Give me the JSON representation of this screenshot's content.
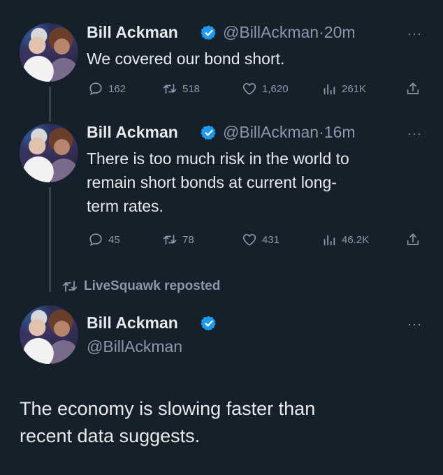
{
  "tweets": [
    {
      "author": "Bill Ackman",
      "handle": "@BillAckman",
      "time_sep": "·",
      "time": "20m",
      "text": "We covered our bond short.",
      "replies": "162",
      "reposts": "518",
      "likes": "1,620",
      "views": "261K"
    },
    {
      "author": "Bill Ackman",
      "handle": "@BillAckman",
      "time_sep": "·",
      "time": "16m",
      "text_lines": [
        "There is too much risk in the world to",
        "remain short bonds at current long-",
        "term rates."
      ],
      "replies": "45",
      "reposts": "78",
      "likes": "431",
      "views": "46.2K"
    }
  ],
  "repost": {
    "label": "LiveSquawk reposted",
    "author": "Bill Ackman",
    "handle": "@BillAckman",
    "text_lines": [
      "The economy is slowing faster than",
      "recent data suggests."
    ]
  },
  "more_label": "···",
  "icons": [
    "reply-icon",
    "repost-icon",
    "like-icon",
    "views-icon",
    "share-icon",
    "verified-badge-icon",
    "more-icon"
  ],
  "colors": {
    "background": "#15202b",
    "text": "#e7e9ea",
    "secondary": "#8b98a5",
    "verified": "#1d9bf0"
  }
}
